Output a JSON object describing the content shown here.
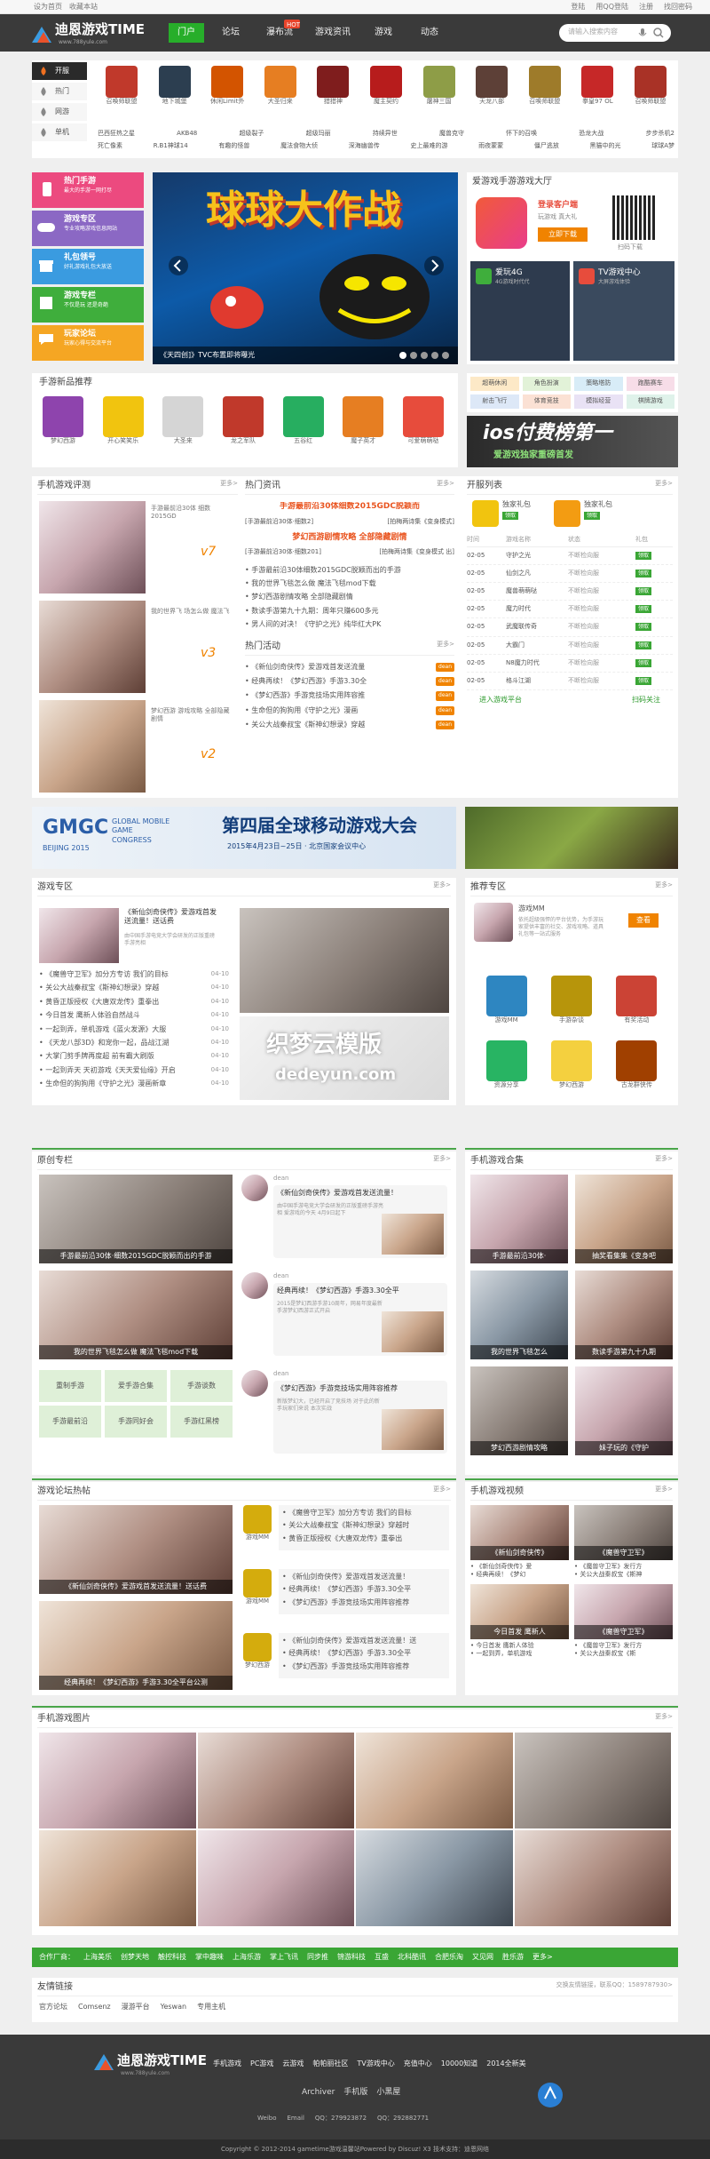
{
  "topbar": {
    "left": [
      "设为首页",
      "收藏本站"
    ],
    "right": [
      "登陆",
      "用QQ登陆",
      "注册",
      "找回密码"
    ]
  },
  "header": {
    "logo": "迪恩游戏TIME",
    "logo_sub": "www.788yule.com",
    "nav": [
      "门户",
      "论坛",
      "瀑布流",
      "游戏资讯",
      "游戏",
      "动态"
    ],
    "search_placeholder": "请输入搜索内容"
  },
  "side_cats": [
    "开服",
    "热门",
    "网游",
    "单机"
  ],
  "top_games": {
    "row1": [
      "召唤师联盟",
      "地下城堡",
      "休闲Limit外",
      "大圣归来",
      "猎猎神",
      "魔主契约",
      "屠神三国",
      "天龙八部",
      "召唤师联盟",
      "拳皇97 OL",
      "召唤师联盟"
    ],
    "row2a": [
      "巴西狂热之星",
      "AKB48",
      "超级裂子",
      "超级玛丽",
      "持续异世",
      "魔兽克守",
      "怀下的召唤",
      "恐龙大战",
      "步步杀机2"
    ],
    "row2b": [
      "死亡像素",
      "R.B1神球14",
      "有趣的怪兽",
      "魔法食物大侦",
      "深海幽兽传",
      "史上最难的游",
      "雨夜蒙蒙",
      "僵尸逃放",
      "黑猫中的光",
      "球球A梦"
    ]
  },
  "features": [
    {
      "t": "热门手游",
      "s": "最大的手游一网打尽"
    },
    {
      "t": "游戏专区",
      "s": "专业攻略游戏信息网站"
    },
    {
      "t": "礼包领号",
      "s": "好礼游戏礼包大放送"
    },
    {
      "t": "游戏专栏",
      "s": "不仅是玩 还是奇葩"
    },
    {
      "t": "玩家论坛",
      "s": "玩家心得与交流平台"
    }
  ],
  "banner": {
    "title": "球球大作战",
    "caption": "《天四创]》TVC布置即将曝光"
  },
  "hall": {
    "title": "爱游戏手游游戏大厅",
    "client": "登录客户端",
    "client_sub": "玩游戏 真大礼",
    "download": "立即下载",
    "qr_label": "扫码下载",
    "p1": "爱玩4G",
    "p1s": "4G游戏时代代",
    "p2": "TV游戏中心",
    "p2s": "大屏游戏体验"
  },
  "tags": [
    "超萌休闲",
    "角色扮演",
    "策略塔防",
    "跑酷赛车",
    "射击飞行",
    "体育竞技",
    "模拟经营",
    "棋牌游戏"
  ],
  "new_games": {
    "title": "手游新品推荐",
    "items": [
      "梦幻西游",
      "开心笑笑乐",
      "大圣来",
      "龙之军队",
      "五谷红",
      "魔子英才",
      "可爱萌萌哒"
    ]
  },
  "ios_banner": {
    "line1": "ios付费榜第一",
    "line2": "爱游戏独家重磅首发"
  },
  "review": {
    "title": "手机游戏评测",
    "more": "更多>",
    "items": [
      {
        "text": "手游最前沿30体 细数2015GD",
        "score": "7"
      },
      {
        "text": "我的世界飞 场怎么做 魔法飞",
        "score": "3"
      },
      {
        "text": "梦幻西游 游戏攻略 全部隐藏 剧情",
        "score": "2"
      }
    ]
  },
  "news": {
    "title": "热门资讯",
    "more": "更多>",
    "headline": "手游最前沿30体细数2015GDC脱颖而",
    "subs": [
      "[手游最前沿30体·细数2]",
      "[拍梅两诗集《变身模式]"
    ],
    "headline2": "梦幻西游剧情攻略 全部隐藏剧情",
    "subs2": [
      "[手游最前沿30体·细数201]",
      "[拍梅两诗集《变身模式 出]"
    ],
    "list": [
      "手游最前沿30体细数2015GDC脱颖而出的手游",
      "我的世界飞毯怎么做 魔法飞毯mod下载",
      "梦幻西游剧情攻略 全部隐藏剧情",
      "数读手游第九十九期：周年只赚600多元",
      "男人间的对决！《守护之光》纯华红大PK"
    ]
  },
  "activity": {
    "title": "热门活动",
    "more": "更多>",
    "list": [
      "《新仙剑奇侠传》爱游戏首发送流量",
      "经典再续！《梦幻西游》手游3.30全",
      "《梦幻西游》手游竞技场实用阵容推",
      "生命但的狗狗用《守护之光》漫画",
      "关公大战秦叔宝《斯神幻想录》穿越"
    ],
    "tag": "dean"
  },
  "server": {
    "title": "开服列表",
    "more": "更多>",
    "gift_label": "独家礼包",
    "gift_btn": "领取",
    "cols": [
      "时间",
      "游戏名称",
      "状态",
      "礼包"
    ],
    "rows": [
      [
        "02-05",
        "守护之光",
        "不断检向服"
      ],
      [
        "02-05",
        "仙剑之凡",
        "不断检向服"
      ],
      [
        "02-05",
        "魔兽萌萌哒",
        "不断检向服"
      ],
      [
        "02-05",
        "魔力时代",
        "不断检向服"
      ],
      [
        "02-05",
        "武魔联传奇",
        "不断检向服"
      ],
      [
        "02-05",
        "大霸门",
        "不断检向服"
      ],
      [
        "02-05",
        "N8魔力时代",
        "不断检向服"
      ],
      [
        "02-05",
        "格斗江湖",
        "不断检向服"
      ]
    ],
    "btn": "领取",
    "enter": "进入游戏平台",
    "wechat": "扫码关注"
  },
  "gmgc": {
    "logo": "GMGC",
    "sub": "GLOBAL MOBILE GAME CONGRESS",
    "beijing": "BEIJING 2015",
    "title": "第四届全球移动游戏大会",
    "date": "2015年4月23日~25日 · 北京国家会议中心"
  },
  "zone": {
    "title": "游戏专区",
    "more": "更多>",
    "feature": "《新仙剑奇侠传》爱游戏首发送流量！送话费",
    "feature_sub": "由中国手游电竞大学会研发的正版重磅手游亮相",
    "list": [
      [
        "《魔兽守卫军》加分方专访 我们的目标",
        "04-10"
      ],
      [
        "关公大战秦叔宝《斯神幻想录》穿越",
        "04-10"
      ],
      [
        "黄昏正版授权《大唐双龙传》重拳出",
        "04-10"
      ],
      [
        "今日首发 鹰新人体验自然战斗",
        "04-10"
      ],
      [
        "一起到弄，单机游戏《蓝火发源》大服",
        "04-10"
      ],
      [
        "《天龙八部3D》和宠你一起，品战江湖",
        "04-10"
      ],
      [
        "大掌门剪手牌再度超 前有霸大刷版",
        "04-10"
      ],
      [
        "一起到弄天 天初游戏《天天爱仙缘》开启",
        "04-10"
      ],
      [
        "生命但的狗狗用《守护之光》漫画新章",
        "04-10"
      ]
    ],
    "watermark": "织梦云模版",
    "watermark2": "dedeyun.com"
  },
  "recommend": {
    "title": "推荐专区",
    "more": "更多>",
    "top_name": "游戏MM",
    "top_desc": "依托超级强悍的平台优势，为手游玩家提供丰富的社交、游戏攻略、道具礼包等一站式服务",
    "top_btn": "查看",
    "items": [
      "游戏MM",
      "手游杂谈",
      "有奖活动",
      "资源分享",
      "梦幻西游",
      "古龙群侠传"
    ]
  },
  "column": {
    "title": "原创专栏",
    "more": "更多>",
    "photos": [
      "手游最前沿30体·细数2015GDC脱颖而出的手游",
      "我的世界飞毯怎么做 魔法飞毯mod下载"
    ],
    "links": [
      "重制手游",
      "爱手游合集",
      "手游谈数",
      "手游最前沿",
      "手游同好会",
      "手游红黑榜"
    ],
    "author": "dean",
    "posts": [
      {
        "t": "《新仙剑奇侠传》爱游戏首发送流量！",
        "d": "由中国手游电竞大学会研发的正版重磅手游亮相 爱游戏的今天 4月9日起下"
      },
      {
        "t": "经典再续！《梦幻西游》手游3.30全平",
        "d": "2015是梦幻西游手游10周年，网易年度最新手游梦幻西游正式开启"
      },
      {
        "t": "《梦幻西游》手游竞技场实用阵容推荐",
        "d": "新版梦幻大，已经开启了竞技场 对于此的新手玩家们来说 本次实战"
      }
    ]
  },
  "collection": {
    "title": "手机游戏合集",
    "more": "更多>",
    "items": [
      "手游最前沿30体·",
      "抽奖看集集《变身吧",
      "我的世界飞毯怎么",
      "数读手游第九十九期",
      "梦幻西游剧情攻略",
      "妹子玩的《守护"
    ]
  },
  "forum": {
    "title": "游戏论坛热帖",
    "more": "更多>",
    "photos": [
      "《新仙剑奇侠传》爱游戏首发送流量！送话费",
      "经典再续！《梦幻西游》手游3.30全平台公测"
    ],
    "users": [
      "游戏MM",
      "游戏MM",
      "梦幻西游"
    ],
    "groups": [
      [
        "《魔兽守卫军》加分方专访 我们的目标",
        "关公大战秦叔宝《斯神幻想录》穿越时",
        "黄昏正版授权《大唐双龙传》重拳出"
      ],
      [
        "《新仙剑奇侠传》爱游戏首发送流量！",
        "经典再续！《梦幻西游》手游3.30全平",
        "《梦幻西游》手游竞技场实用阵容推荐"
      ],
      [
        "《新仙剑奇侠传》爱游戏首发送流量！送",
        "经典再续！《梦幻西游》手游3.30全平",
        "《梦幻西游》手游竞技场实用阵容推荐"
      ]
    ]
  },
  "video": {
    "title": "手机游戏视频",
    "more": "更多>",
    "items": [
      {
        "cap": "《新仙剑奇侠传》",
        "l1": "《新仙剑奇侠传》爱",
        "l2": "经典再续！《梦幻"
      },
      {
        "cap": "《魔兽守卫军》",
        "l1": "《魔兽守卫军》发行方",
        "l2": "关公大战秦叔宝《斯神"
      },
      {
        "cap": "今日首发 鹰新人",
        "l1": "今日首发 鹰新人体验",
        "l2": "一起到弄，单机游戏"
      },
      {
        "cap": "《魔兽守卫军》",
        "l1": "《魔兽守卫军》发行方",
        "l2": "关公大战秦叔宝《斯"
      }
    ]
  },
  "gallery": {
    "title": "手机游戏图片",
    "more": "更多>"
  },
  "partners": [
    "合作厂商：",
    "上海美乐",
    "创梦天地",
    "触控科技",
    "掌中趣味",
    "上海乐游",
    "掌上飞讯",
    "同步推",
    "锦游科技",
    "互盛",
    "北科酷讯",
    "合肥乐淘",
    "又见网",
    "胜乐游",
    "更多>"
  ],
  "friends": {
    "title": "友情链接",
    "note": "交换友情链接，联系QQ：1589787930>",
    "links": [
      "官方论坛",
      "Comsenz",
      "漫游平台",
      "Yeswan",
      "专用主机"
    ]
  },
  "footer": {
    "logo": "迪恩游戏TIME",
    "logo_sub": "www.788yule.com",
    "links": [
      "手机游戏",
      "PC游戏",
      "云游戏",
      "帕帕丽社区",
      "TV游戏中心",
      "充值中心",
      "10000知道",
      "2014全新美"
    ],
    "sub": [
      "Archiver",
      "手机版",
      "小黑屋"
    ],
    "contact": [
      "Weibo",
      "Email",
      "QQ：279923872",
      "QQ：292882771"
    ],
    "copyright": "Copyright © 2012-2014 gametime游戏温馨站Powered by Discuz! X3 技术支持：迪恩网络"
  }
}
